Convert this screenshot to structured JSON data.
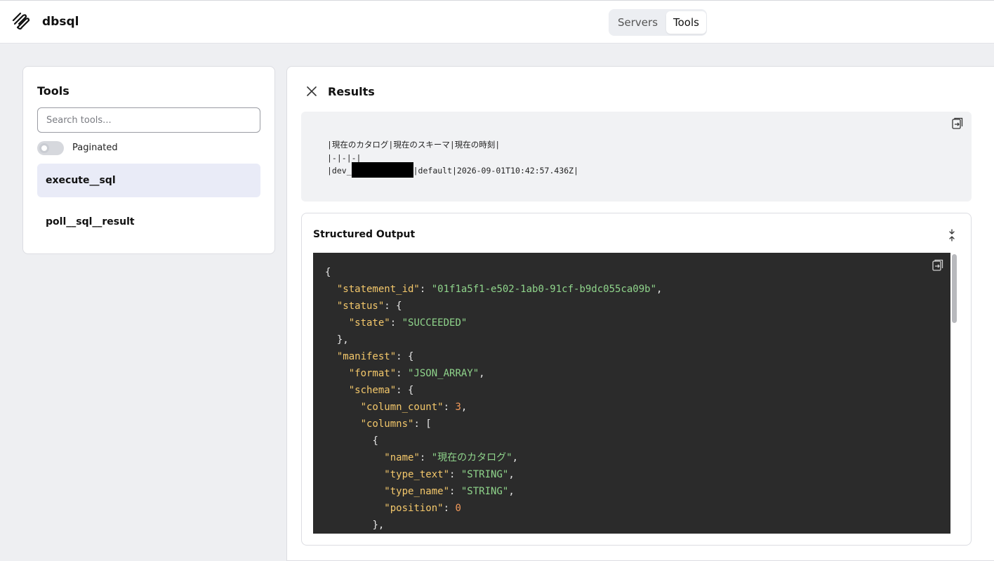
{
  "app": {
    "name": "dbsql",
    "logo_icon": "layers-icon"
  },
  "nav": {
    "tabs": [
      {
        "label": "Servers",
        "active": false
      },
      {
        "label": "Tools",
        "active": true
      }
    ]
  },
  "tools_panel": {
    "title": "Tools",
    "search_placeholder": "Search tools...",
    "paginated_label": "Paginated",
    "paginated_on": false,
    "items": [
      {
        "label": "execute__sql",
        "selected": true
      },
      {
        "label": "poll__sql__result",
        "selected": false
      }
    ]
  },
  "results": {
    "title": "Results",
    "text_output": {
      "line1": "|現在のカタログ|現在のスキーマ|現在の時刻|",
      "line2": "|-|-|-|",
      "line3_prefix": "|dev_",
      "line3_suffix": "|default|2026-09-01T10:42:57.436Z|"
    },
    "structured_output": {
      "title": "Structured Output",
      "json": {
        "statement_id_key": "\"statement_id\"",
        "statement_id_val": "\"01f1a5f1-e502-1ab0-91cf-b9dc055ca09b\"",
        "status_key": "\"status\"",
        "state_key": "\"state\"",
        "state_val": "\"SUCCEEDED\"",
        "manifest_key": "\"manifest\"",
        "format_key": "\"format\"",
        "format_val": "\"JSON_ARRAY\"",
        "schema_key": "\"schema\"",
        "column_count_key": "\"column_count\"",
        "column_count_val": "3",
        "columns_key": "\"columns\"",
        "name_key": "\"name\"",
        "name_val": "\"現在のカタログ\"",
        "type_text_key": "\"type_text\"",
        "type_text_val": "\"STRING\"",
        "type_name_key": "\"type_name\"",
        "type_name_val": "\"STRING\"",
        "position_key": "\"position\"",
        "position_val": "0"
      }
    }
  }
}
